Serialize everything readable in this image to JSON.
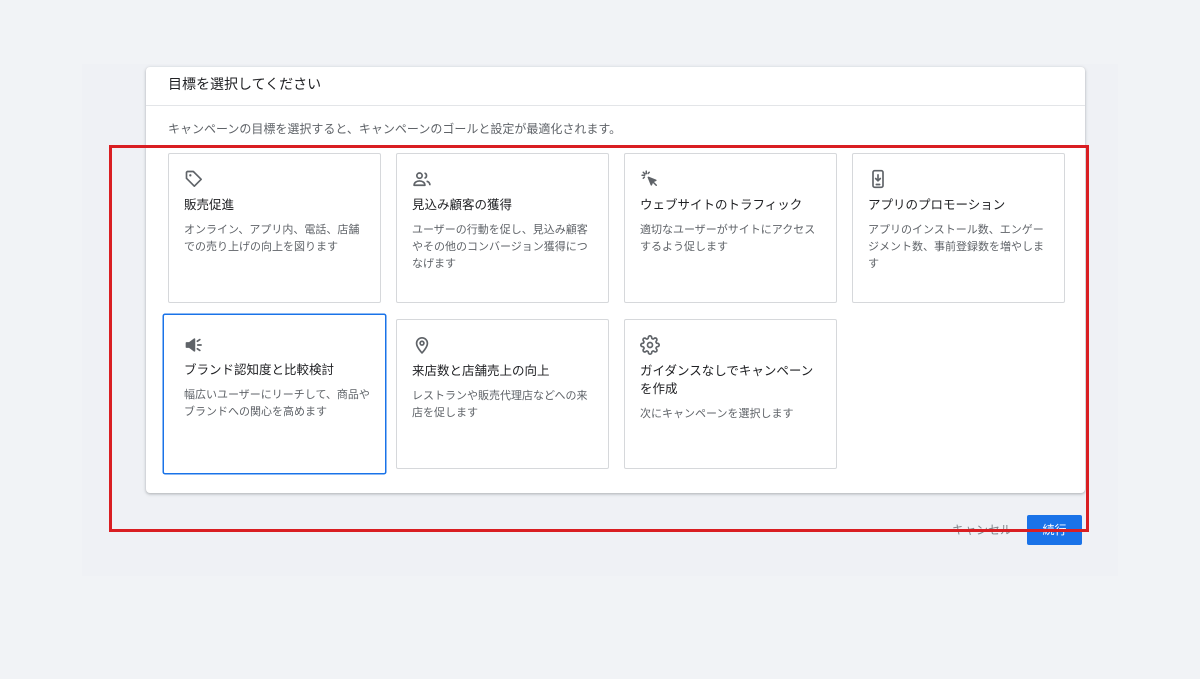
{
  "dialog": {
    "title": "目標を選択してください",
    "description": "キャンペーンの目標を選択すると、キャンペーンのゴールと設定が最適化されます。"
  },
  "goals": [
    {
      "icon": "tag-icon",
      "title": "販売促進",
      "description": "オンライン、アプリ内、電話、店舗での売り上げの向上を図ります",
      "selected": false
    },
    {
      "icon": "people-icon",
      "title": "見込み顧客の獲得",
      "description": "ユーザーの行動を促し、見込み顧客やその他のコンバージョン獲得につなげます",
      "selected": false
    },
    {
      "icon": "cursor-click-icon",
      "title": "ウェブサイトのトラフィック",
      "description": "適切なユーザーがサイトにアクセスするよう促します",
      "selected": false
    },
    {
      "icon": "phone-download-icon",
      "title": "アプリのプロモーション",
      "description": "アプリのインストール数、エンゲージメント数、事前登録数を増やします",
      "selected": false
    },
    {
      "icon": "megaphone-icon",
      "title": "ブランド認知度と比較検討",
      "description": "幅広いユーザーにリーチして、商品やブランドへの関心を高めます",
      "selected": true
    },
    {
      "icon": "location-pin-icon",
      "title": "来店数と店舗売上の向上",
      "description": "レストランや販売代理店などへの来店を促します",
      "selected": false
    },
    {
      "icon": "gear-icon",
      "title": "ガイダンスなしでキャンペーンを作成",
      "description": "次にキャンペーンを選択します",
      "selected": false
    }
  ],
  "footer": {
    "cancel_label": "キャンセル",
    "continue_label": "続行"
  },
  "colors": {
    "accent": "#1a73e8",
    "highlight": "#d91e22",
    "icon": "#5f6368"
  }
}
